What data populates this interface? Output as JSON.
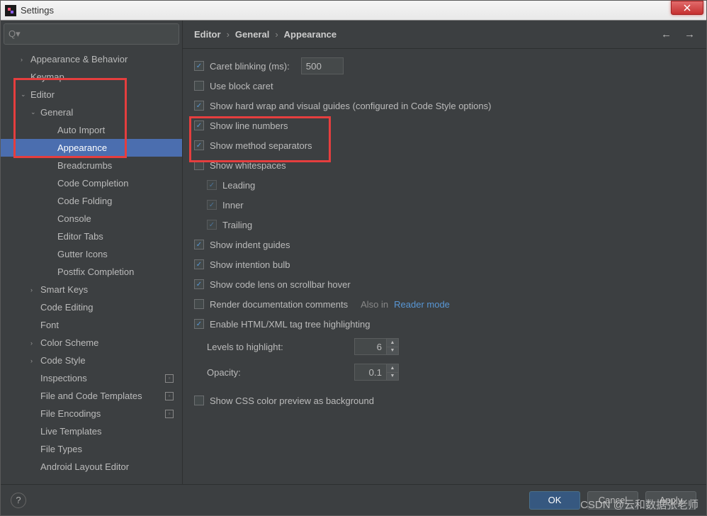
{
  "window_title": "Settings",
  "search_placeholder": "",
  "sidebar": {
    "items": [
      {
        "label": "Appearance & Behavior",
        "level": 1,
        "caret": "›"
      },
      {
        "label": "Keymap",
        "level": 1,
        "caret": ""
      },
      {
        "label": "Editor",
        "level": 1,
        "caret": "⌄"
      },
      {
        "label": "General",
        "level": 2,
        "caret": "⌄"
      },
      {
        "label": "Auto Import",
        "level": 3,
        "caret": ""
      },
      {
        "label": "Appearance",
        "level": 3,
        "caret": "",
        "selected": true
      },
      {
        "label": "Breadcrumbs",
        "level": 3,
        "caret": ""
      },
      {
        "label": "Code Completion",
        "level": 3,
        "caret": ""
      },
      {
        "label": "Code Folding",
        "level": 3,
        "caret": ""
      },
      {
        "label": "Console",
        "level": 3,
        "caret": ""
      },
      {
        "label": "Editor Tabs",
        "level": 3,
        "caret": ""
      },
      {
        "label": "Gutter Icons",
        "level": 3,
        "caret": ""
      },
      {
        "label": "Postfix Completion",
        "level": 3,
        "caret": ""
      },
      {
        "label": "Smart Keys",
        "level": 2,
        "caret": "›"
      },
      {
        "label": "Code Editing",
        "level": 2,
        "caret": ""
      },
      {
        "label": "Font",
        "level": 2,
        "caret": ""
      },
      {
        "label": "Color Scheme",
        "level": 2,
        "caret": "›"
      },
      {
        "label": "Code Style",
        "level": 2,
        "caret": "›"
      },
      {
        "label": "Inspections",
        "level": 2,
        "caret": "",
        "badge": true
      },
      {
        "label": "File and Code Templates",
        "level": 2,
        "caret": "",
        "badge": true
      },
      {
        "label": "File Encodings",
        "level": 2,
        "caret": "",
        "badge": true
      },
      {
        "label": "Live Templates",
        "level": 2,
        "caret": ""
      },
      {
        "label": "File Types",
        "level": 2,
        "caret": ""
      },
      {
        "label": "Android Layout Editor",
        "level": 2,
        "caret": ""
      }
    ]
  },
  "breadcrumb": [
    "Editor",
    "General",
    "Appearance"
  ],
  "settings": {
    "caret_blinking_label": "Caret blinking (ms):",
    "caret_blinking_value": "500",
    "use_block_caret": "Use block caret",
    "show_hard_wrap": "Show hard wrap and visual guides (configured in Code Style options)",
    "show_line_numbers": "Show line numbers",
    "show_method_separators": "Show method separators",
    "show_whitespaces": "Show whitespaces",
    "leading": "Leading",
    "inner": "Inner",
    "trailing": "Trailing",
    "show_indent_guides": "Show indent guides",
    "show_intention_bulb": "Show intention bulb",
    "show_code_lens": "Show code lens on scrollbar hover",
    "render_doc": "Render documentation comments",
    "also_in": "Also in",
    "reader_mode": "Reader mode",
    "enable_html_tag": "Enable HTML/XML tag tree highlighting",
    "levels_label": "Levels to highlight:",
    "levels_value": "6",
    "opacity_label": "Opacity:",
    "opacity_value": "0.1",
    "show_css_preview": "Show CSS color preview as background"
  },
  "footer": {
    "ok": "OK",
    "cancel": "Cancel",
    "apply": "Apply"
  },
  "watermark": "CSDN @云和数据张老师"
}
